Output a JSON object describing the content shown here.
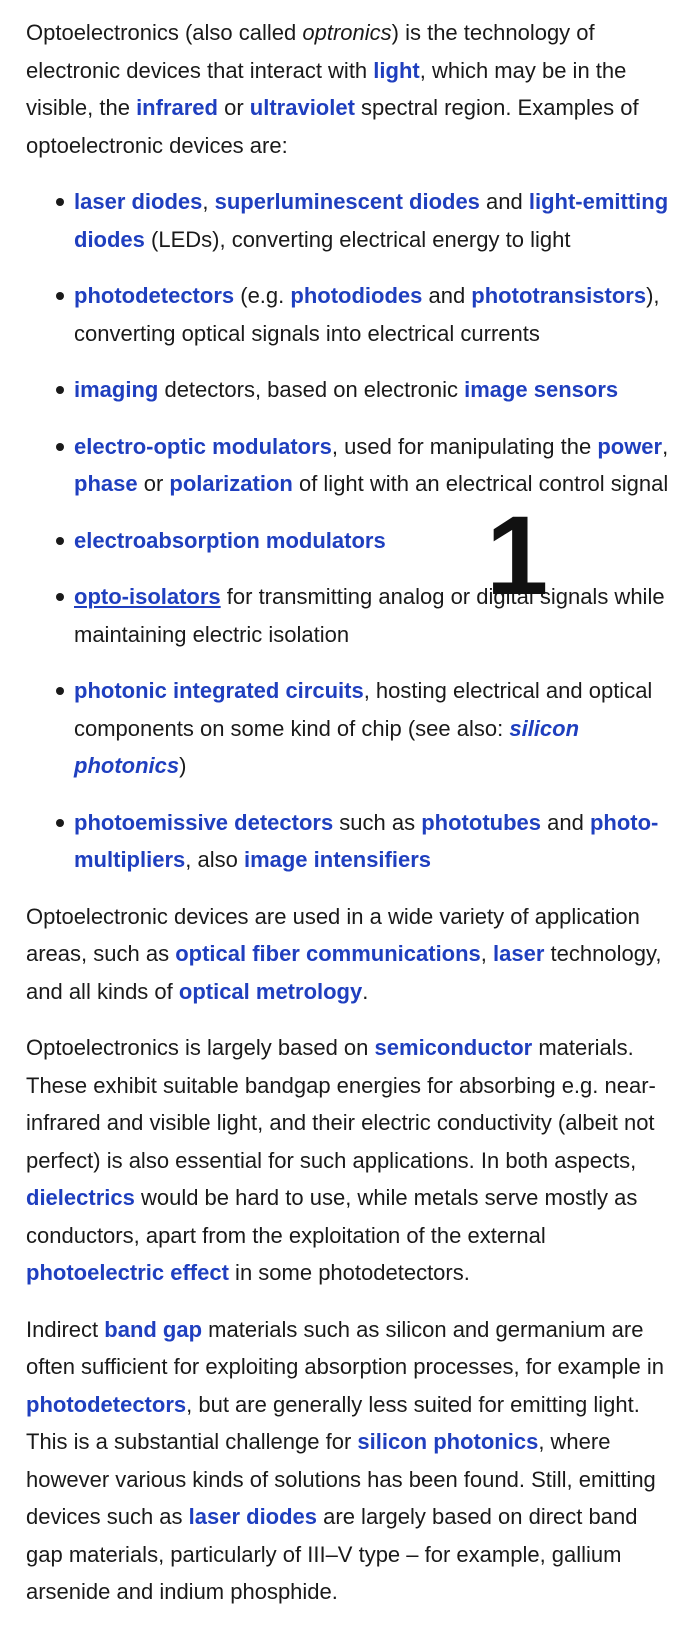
{
  "intro": {
    "t1": "Optoelectronics (also called ",
    "t2": "optronics",
    "t3": ") is the technology of electronic devices that interact with ",
    "l1": "light",
    "t4": ", which may be in the visible, the ",
    "l2": "infrared",
    "t5": " or ",
    "l3": "ultraviolet",
    "t6": " spectral region. Examples of optoelectronic devices are:"
  },
  "devices": [
    {
      "l1": "laser diodes",
      "t1": ", ",
      "l2": "superluminescent diodes",
      "t2": " and ",
      "l3": "light-emit­ting diodes",
      "t3": " (LEDs), converting electrical energy to light"
    },
    {
      "l1": "photodetectors",
      "t1": " (e.g. ",
      "l2": "photodiodes",
      "t2": " and ",
      "l3": "phototransistors",
      "t3": "), converting optical signals into electrical currents"
    },
    {
      "l1": "imaging",
      "t1": " detectors, based on electronic ",
      "l2": "image sensors"
    },
    {
      "l1": "electro-optic modulators",
      "t1": ", used for manipulating the ",
      "l2": "power",
      "t2": ", ",
      "l3": "phase",
      "t3": " or ",
      "l4": "polarization",
      "t4": " of light with an electrical control signal"
    },
    {
      "l1": "electroabsorption modulators"
    },
    {
      "l1": "opto-isolators",
      "t1": " for transmitting analog or digital signals while maintaining electric isolation"
    },
    {
      "l1": "photonic integrated circuits",
      "t1": ", hosting electrical and opti­cal components on some kind of chip (see also: ",
      "l2": "silicon photonics",
      "t2": ")"
    },
    {
      "l1": "photoemissive detectors",
      "t1": " such as ",
      "l2": "phototubes",
      "t2": " and ",
      "l3": "photo­multipliers",
      "t3": ", also ",
      "l4": "image intensifiers"
    }
  ],
  "para2": {
    "t1": "Optoelectronic devices are used in a wide variety of applica­tion areas, such as ",
    "l1": "optical fiber communications",
    "t2": ", ",
    "l2": "laser",
    "t3": " tech­nology, and all kinds of ",
    "l3": "optical metrology",
    "t4": "."
  },
  "para3": {
    "t1": "Optoelectronics is largely based on ",
    "l1": "semiconductor",
    "t2": " materials. These exhibit suitable bandgap energies for absorbing e.g. near-infrared and visible light, and their electric conductivity (albeit not perfect) is also essential for such applications. In both aspects, ",
    "l2": "dielectrics",
    "t3": " would be hard to use, while metals serve mostly as conductors, apart from the exploitation of the external ",
    "l3": "photoelectric effect",
    "t4": " in some photodetectors."
  },
  "para4": {
    "t1": "Indirect ",
    "l1": "band gap",
    "t2": " materials such as silicon and germanium are often sufficient for exploiting absorption processes, for example in ",
    "l2": "photodetectors",
    "t3": ", but are generally less suited for emitting light. This is a substantial challenge for ",
    "l3": "silicon pho­tonics",
    "t4": ", where however various kinds of solutions has been found. Still, emitting devices such as ",
    "l4": "laser diodes",
    "t5": " are largely based on direct band gap materials, particularly of III–V type – for example, gallium arsenide and indium phosphide."
  },
  "badge": "1",
  "colors": {
    "link": "#1f3fbf",
    "text": "#1a1a1a"
  }
}
